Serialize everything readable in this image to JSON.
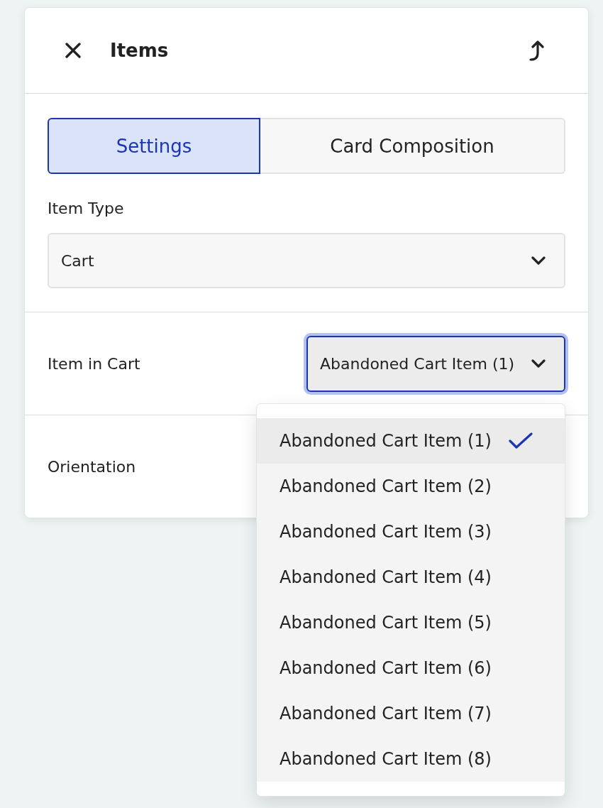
{
  "panel": {
    "title": "Items"
  },
  "tabs": [
    {
      "label": "Settings",
      "selected": true
    },
    {
      "label": "Card Composition",
      "selected": false
    }
  ],
  "item_type": {
    "label": "Item Type",
    "value": "Cart"
  },
  "item_in_cart": {
    "label": "Item in Cart",
    "value": "Abandoned Cart Item (1)",
    "focused": true,
    "expanded": true
  },
  "orientation": {
    "label": "Orientation"
  },
  "menu": {
    "items": [
      {
        "label": "Abandoned Cart Item (1)",
        "selected": true
      },
      {
        "label": "Abandoned Cart Item (2)",
        "selected": false
      },
      {
        "label": "Abandoned Cart Item (3)",
        "selected": false
      },
      {
        "label": "Abandoned Cart Item (4)",
        "selected": false
      },
      {
        "label": "Abandoned Cart Item (5)",
        "selected": false
      },
      {
        "label": "Abandoned Cart Item (6)",
        "selected": false
      },
      {
        "label": "Abandoned Cart Item (7)",
        "selected": false
      },
      {
        "label": "Abandoned Cart Item (8)",
        "selected": false
      }
    ]
  }
}
